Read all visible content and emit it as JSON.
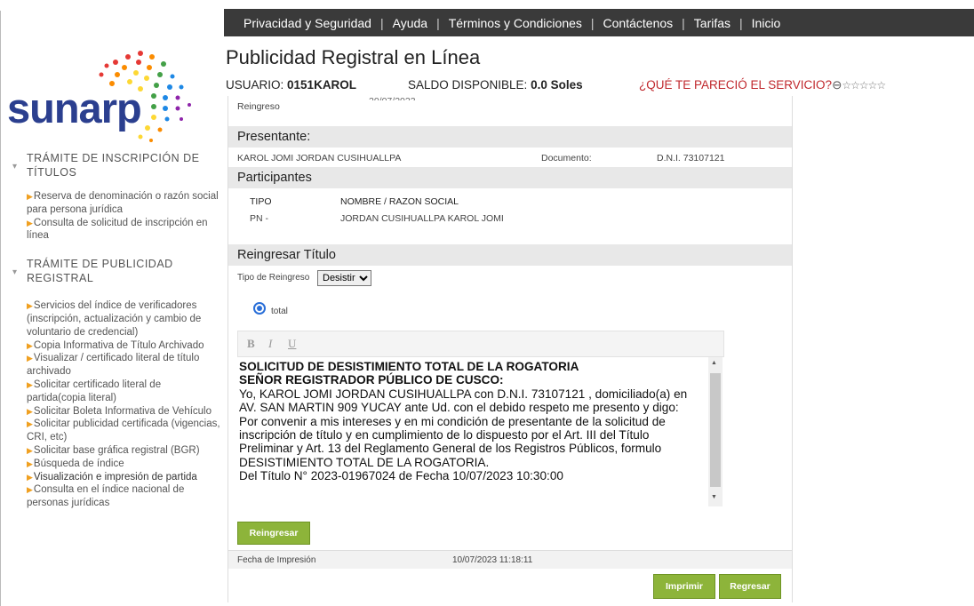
{
  "nav": {
    "items": [
      "Privacidad y Seguridad",
      "Ayuda",
      "Términos y Condiciones",
      "Contáctenos",
      "Tarifas",
      "Inicio"
    ]
  },
  "logo": {
    "text": "sunarp"
  },
  "sidebar": {
    "sections": [
      {
        "title": "TRÁMITE DE INSCRIPCIÓN DE TÍTULOS",
        "links": [
          "Reserva de denominación o razón social para persona jurídica",
          "Consulta de solicitud de inscripción en línea"
        ]
      },
      {
        "title": "TRÁMITE DE PUBLICIDAD REGISTRAL",
        "links": [
          "Servicios del índice de verificadores (inscripción, actualización y cambio de voluntario de credencial)",
          "Copia Informativa de Título Archivado",
          "Visualizar / certificado literal de título archivado",
          "Solicitar certificado literal de partida(copia literal)",
          "Solicitar Boleta Informativa de Vehículo",
          "Solicitar publicidad certificada (vigencias, CRI, etc)",
          "Solicitar base gráfica registral (BGR)",
          "Búsqueda de índice",
          "Visualización e impresión de partida",
          "Consulta en el índice nacional de personas jurídicas"
        ]
      }
    ]
  },
  "header": {
    "title": "Publicidad Registral en Línea",
    "user_label": "USUARIO:",
    "user_value": "0151KAROL",
    "balance_label": "SALDO DISPONIBLE:",
    "balance_value": "0.0 Soles",
    "feedback": "¿QUÉ TE PARECIÓ EL SERVICIO?",
    "stars": "☆☆☆☆☆",
    "rating": 0
  },
  "panel": {
    "reingreso_label": "Reingreso",
    "presentante_title": "Presentante:",
    "presentante_name": "KAROL JOMI JORDAN CUSIHUALLPA",
    "documento_label": "Documento:",
    "documento_value": "D.N.I. 73107121",
    "participantes_title": "Participantes",
    "tipo_header": "TIPO",
    "nombre_header": "NOMBRE / RAZON SOCIAL",
    "participant_tipo": "PN -",
    "participant_nombre": "JORDAN CUSIHUALLPA KAROL JOMI",
    "reingresar_title": "Reingresar Título",
    "tipo_reingreso_label": "Tipo de Reingreso",
    "tipo_reingreso_value": "Desistir",
    "radio_label": "total",
    "editor_toolbar": [
      "B",
      "I",
      "U"
    ],
    "editor": {
      "line1": "SOLICITUD DE DESISTIMIENTO TOTAL DE LA ROGATORIA",
      "line2": "SEÑOR REGISTRADOR PÚBLICO DE CUSCO:",
      "body": "Yo, KAROL JOMI JORDAN CUSIHUALLPA con D.N.I. 73107121 , domiciliado(a) en AV. SAN MARTIN 909 YUCAY ante Ud. con el debido respeto me presento y digo:",
      "body2": "Por convenir a mis intereses y en mi condición de presentante de la solicitud de inscripción de título y en cumplimiento de lo dispuesto por el Art. III del Título Preliminar y Art. 13 del Reglamento General de los Registros Públicos, formulo DESISTIMIENTO TOTAL DE LA ROGATORIA.",
      "body3": "Del Título N° 2023-01967024 de Fecha 10/07/2023 10:30:00"
    },
    "reingresar_button": "Reingresar",
    "fecha_label": "Fecha de Impresión",
    "fecha_value": "10/07/2023 11:18:11",
    "imprimir_button": "Imprimir",
    "regresar_button": "Regresar"
  }
}
